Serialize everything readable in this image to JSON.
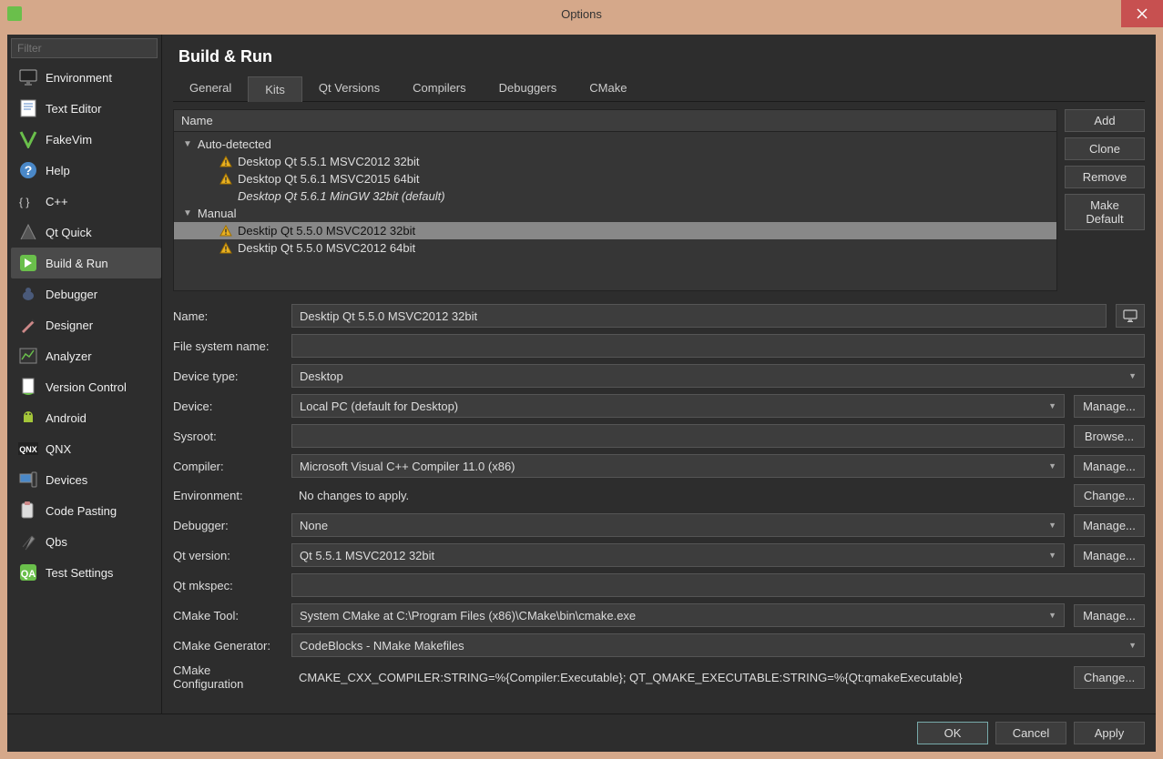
{
  "window": {
    "title": "Options"
  },
  "filter": {
    "placeholder": "Filter"
  },
  "sidebar": {
    "items": [
      {
        "label": "Environment",
        "icon": "monitor"
      },
      {
        "label": "Text Editor",
        "icon": "text"
      },
      {
        "label": "FakeVim",
        "icon": "fakevim"
      },
      {
        "label": "Help",
        "icon": "help"
      },
      {
        "label": "C++",
        "icon": "cpp"
      },
      {
        "label": "Qt Quick",
        "icon": "qtquick"
      },
      {
        "label": "Build & Run",
        "icon": "buildrun",
        "selected": true
      },
      {
        "label": "Debugger",
        "icon": "debugger"
      },
      {
        "label": "Designer",
        "icon": "designer"
      },
      {
        "label": "Analyzer",
        "icon": "analyzer"
      },
      {
        "label": "Version Control",
        "icon": "vcs"
      },
      {
        "label": "Android",
        "icon": "android"
      },
      {
        "label": "QNX",
        "icon": "qnx"
      },
      {
        "label": "Devices",
        "icon": "devices"
      },
      {
        "label": "Code Pasting",
        "icon": "paste"
      },
      {
        "label": "Qbs",
        "icon": "qbs"
      },
      {
        "label": "Test Settings",
        "icon": "test"
      }
    ]
  },
  "pane": {
    "title": "Build & Run"
  },
  "tabs": [
    "General",
    "Kits",
    "Qt Versions",
    "Compilers",
    "Debuggers",
    "CMake"
  ],
  "active_tab": "Kits",
  "tree": {
    "header": "Name",
    "groups": [
      {
        "label": "Auto-detected",
        "items": [
          {
            "label": "Desktop Qt 5.5.1 MSVC2012 32bit",
            "warn": true
          },
          {
            "label": "Desktop Qt 5.6.1 MSVC2015 64bit",
            "warn": true
          },
          {
            "label": "Desktop Qt 5.6.1 MinGW 32bit (default)",
            "warn": false,
            "italic": true
          }
        ]
      },
      {
        "label": "Manual",
        "items": [
          {
            "label": "Desktip Qt 5.5.0 MSVC2012 32bit",
            "warn": true,
            "selected": true
          },
          {
            "label": "Desktip Qt 5.5.0 MSVC2012 64bit",
            "warn": true
          }
        ]
      }
    ]
  },
  "tree_buttons": {
    "add": "Add",
    "clone": "Clone",
    "remove": "Remove",
    "make_default": "Make Default"
  },
  "form": {
    "name_label": "Name:",
    "name_value": "Desktip Qt 5.5.0 MSVC2012 32bit",
    "fsname_label": "File system name:",
    "fsname_value": "",
    "devtype_label": "Device type:",
    "devtype_value": "Desktop",
    "device_label": "Device:",
    "device_value": "Local PC (default for Desktop)",
    "device_btn": "Manage...",
    "sysroot_label": "Sysroot:",
    "sysroot_value": "",
    "sysroot_btn": "Browse...",
    "compiler_label": "Compiler:",
    "compiler_value": "Microsoft Visual C++ Compiler 11.0 (x86)",
    "compiler_btn": "Manage...",
    "env_label": "Environment:",
    "env_value": "No changes to apply.",
    "env_btn": "Change...",
    "debugger_label": "Debugger:",
    "debugger_value": "None",
    "debugger_btn": "Manage...",
    "qtver_label": "Qt version:",
    "qtver_value": "Qt 5.5.1 MSVC2012 32bit",
    "qtver_btn": "Manage...",
    "mkspec_label": "Qt mkspec:",
    "mkspec_value": "",
    "cmaketool_label": "CMake Tool:",
    "cmaketool_value": "System CMake at C:\\Program Files (x86)\\CMake\\bin\\cmake.exe",
    "cmaketool_btn": "Manage...",
    "cmakegen_label": "CMake Generator:",
    "cmakegen_value": "CodeBlocks - NMake Makefiles",
    "cmakecfg_label": "CMake Configuration",
    "cmakecfg_value": "CMAKE_CXX_COMPILER:STRING=%{Compiler:Executable}; QT_QMAKE_EXECUTABLE:STRING=%{Qt:qmakeExecutable}",
    "cmakecfg_btn": "Change..."
  },
  "footer": {
    "ok": "OK",
    "cancel": "Cancel",
    "apply": "Apply"
  }
}
